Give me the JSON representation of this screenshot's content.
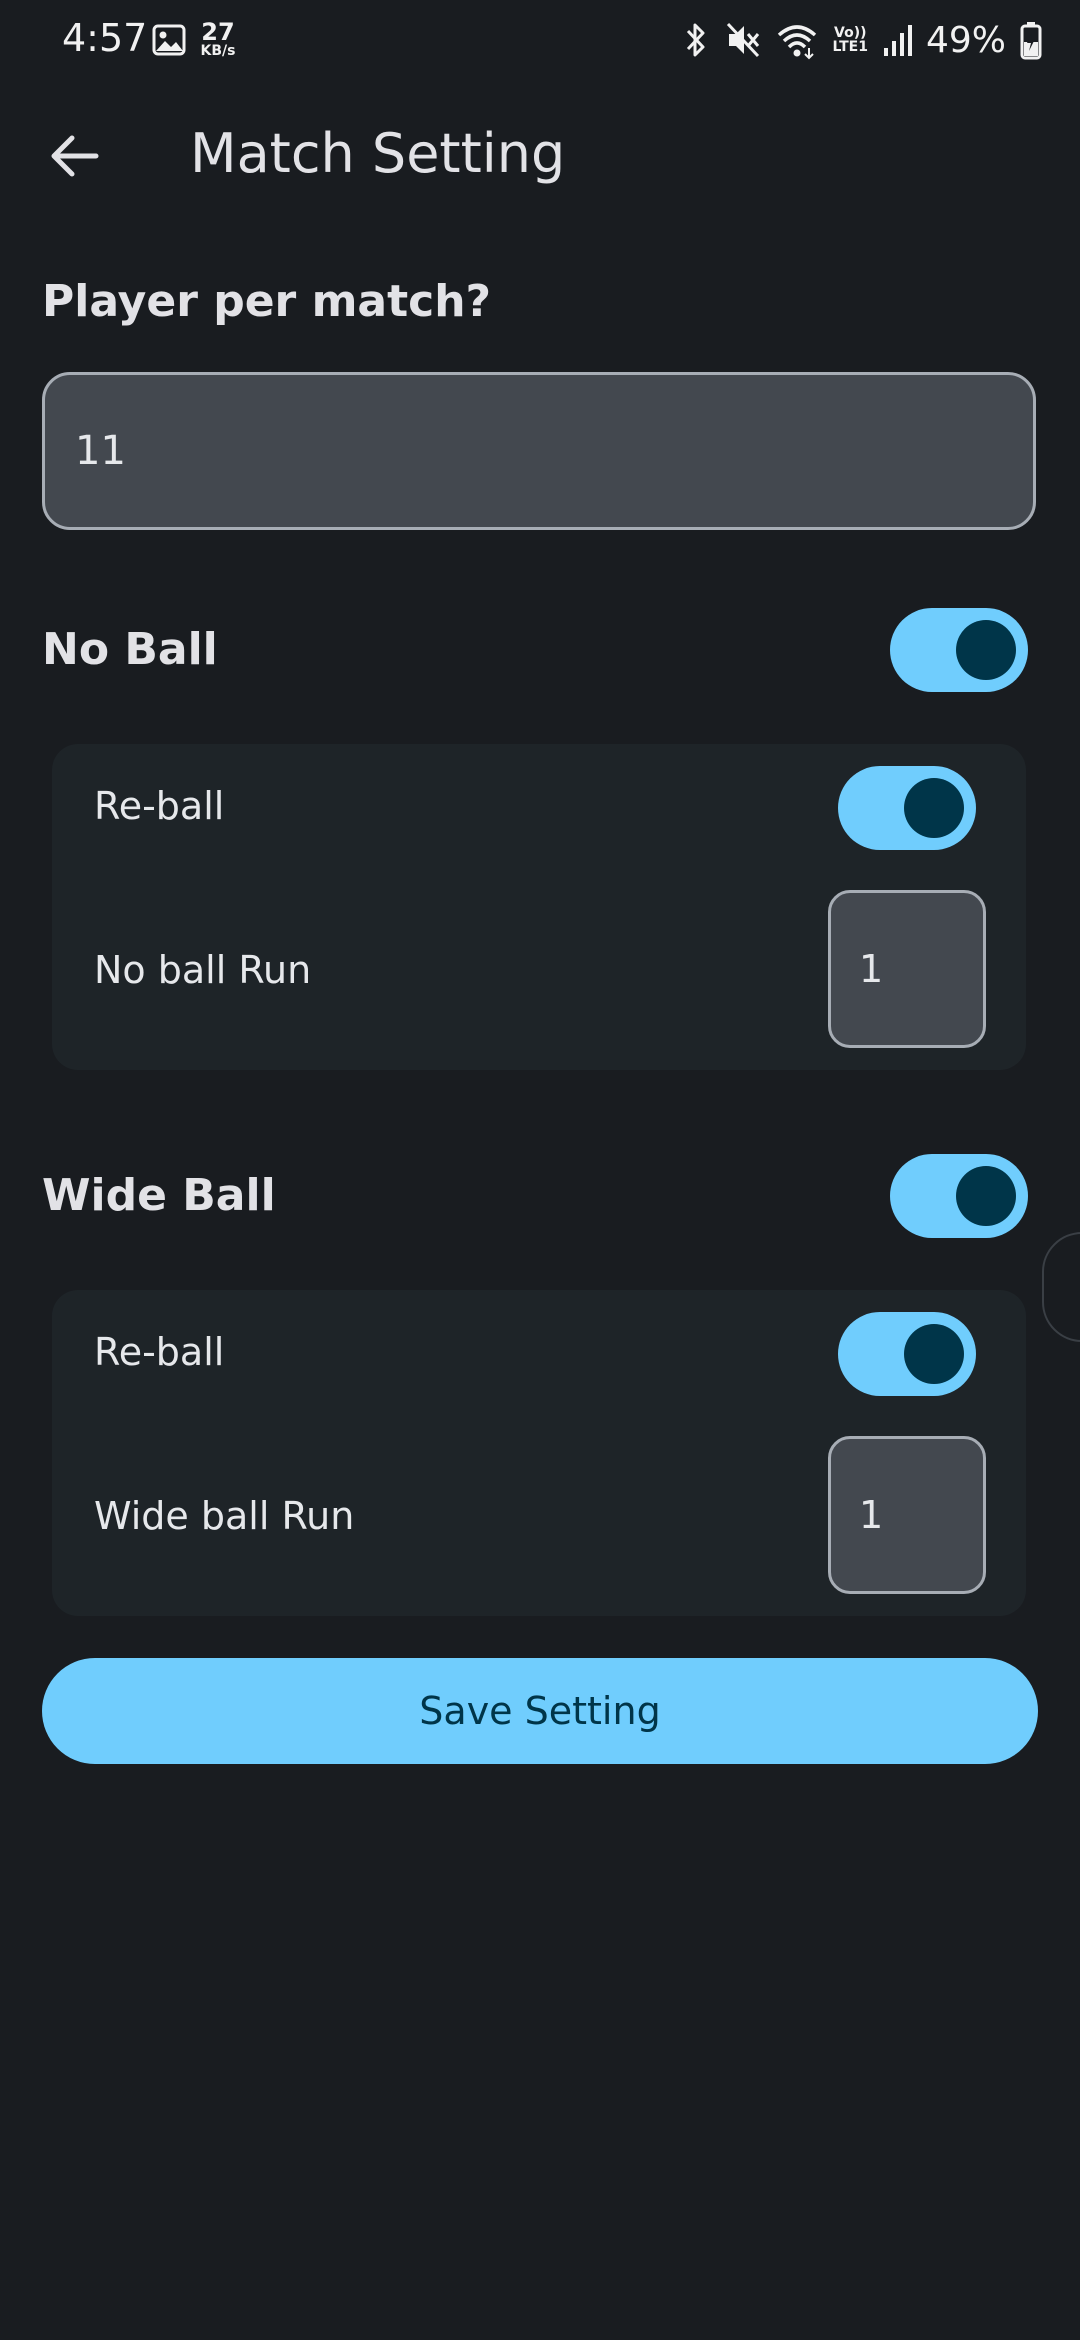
{
  "status_bar": {
    "time": "4:57",
    "net_speed_value": "27",
    "net_speed_unit": "KB/s",
    "network_label_top": "Vo))",
    "network_label_bottom": "LTE1",
    "battery_percent": "49%"
  },
  "app_bar": {
    "title": "Match Setting",
    "back_icon": "arrow-left"
  },
  "players": {
    "label": "Player per match?",
    "value": "11"
  },
  "no_ball": {
    "label": "No Ball",
    "enabled": true,
    "reball_label": "Re-ball",
    "reball_enabled": true,
    "run_label": "No ball Run",
    "run_value": "1"
  },
  "wide_ball": {
    "label": "Wide Ball",
    "enabled": true,
    "reball_label": "Re-ball",
    "reball_enabled": true,
    "run_label": "Wide ball Run",
    "run_value": "1"
  },
  "actions": {
    "save_label": "Save Setting"
  },
  "colors": {
    "background": "#191c20",
    "accent": "#70cdfd",
    "on_accent": "#003549",
    "card": "#1e2428",
    "field": "#43484f"
  }
}
